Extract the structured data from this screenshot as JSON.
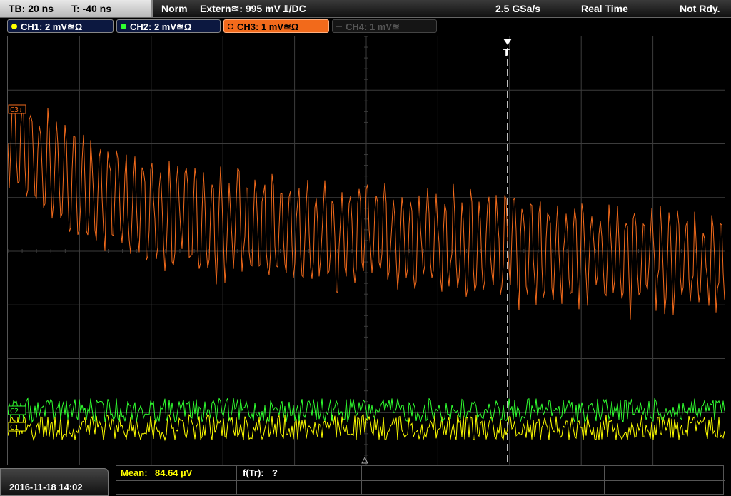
{
  "topbar": {
    "timebase": "TB: 20 ns",
    "trigger_time": "T: -40 ns",
    "trigger_mode": "Norm",
    "trigger_source": "Extern≊: 995 mV ⫫/DC",
    "sample_rate": "2.5 GSa/s",
    "acq_mode": "Real Time",
    "status": "Not Rdy."
  },
  "channels": [
    {
      "id": "ch1",
      "label": "CH1: 2 mV≊Ω",
      "color": "#ffff00"
    },
    {
      "id": "ch2",
      "label": "CH2: 2 mV≊Ω",
      "color": "#30ff30"
    },
    {
      "id": "ch3",
      "label": "CH3: 1 mV≊Ω",
      "color": "#f26a1b"
    },
    {
      "id": "ch4",
      "label": "CH4: 1 mV≊",
      "color": "#555555"
    }
  ],
  "screen": {
    "ch3_marker": "C3↓",
    "ch2_marker": "C2",
    "ch1_marker": "C1",
    "trigger_marker": "T",
    "colors": {
      "grid": "#3c3c3c",
      "ch3_trace": "#f26a1b",
      "ch2_trace": "#30ff30",
      "ch1_trace": "#ffff00"
    }
  },
  "bottom": {
    "datetime": "2016-11-18 14:02",
    "mean_label": "Mean:",
    "mean_value": "84.64 µV",
    "freq_label": "f(Tr):",
    "freq_value": "?"
  }
}
